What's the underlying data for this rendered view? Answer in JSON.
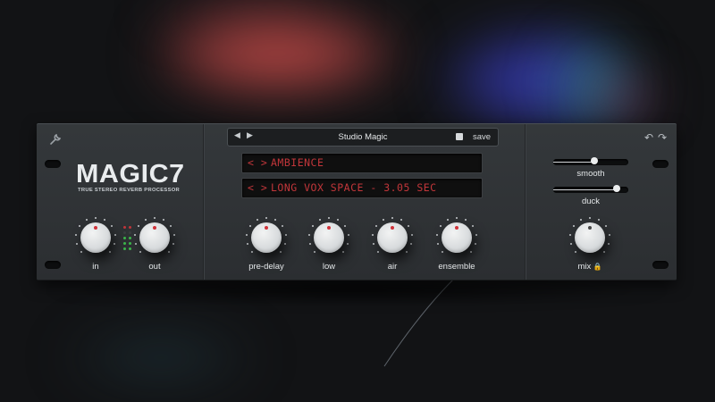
{
  "plugin": {
    "logo": "MAGIC7",
    "tagline": "TRUE STEREO REVERB PROCESSOR"
  },
  "icons": {
    "settings": "wrench-icon",
    "prev": "triangle-left-icon",
    "next": "triangle-right-icon",
    "compare": "square-icon",
    "undo": "undo-icon",
    "redo": "redo-icon",
    "lock": "lock-icon"
  },
  "preset_bar": {
    "prev_label": "◀",
    "next_label": "▶",
    "name": "Studio Magic",
    "save_label": "save"
  },
  "displays": {
    "category_nav": "< >",
    "category": "AMBIENCE",
    "program_nav": "< >",
    "program": "LONG VOX SPACE - 3.05 SEC"
  },
  "history": {
    "undo_label": "↶",
    "redo_label": "↷"
  },
  "knobs": [
    {
      "id": "in",
      "label": "in"
    },
    {
      "id": "out",
      "label": "out"
    },
    {
      "id": "pre-delay",
      "label": "pre-delay"
    },
    {
      "id": "low",
      "label": "low"
    },
    {
      "id": "air",
      "label": "air"
    },
    {
      "id": "ensemble",
      "label": "ensemble"
    },
    {
      "id": "mix",
      "label": "mix"
    }
  ],
  "mix_lock": "🔒",
  "sliders": [
    {
      "id": "smooth",
      "label": "smooth",
      "value": 0.55
    },
    {
      "id": "duck",
      "label": "duck",
      "value": 0.85
    }
  ],
  "meter": {
    "colors": {
      "red": "#c0353a",
      "green": "#3bb54a",
      "dim": "#3a3d3f"
    }
  }
}
